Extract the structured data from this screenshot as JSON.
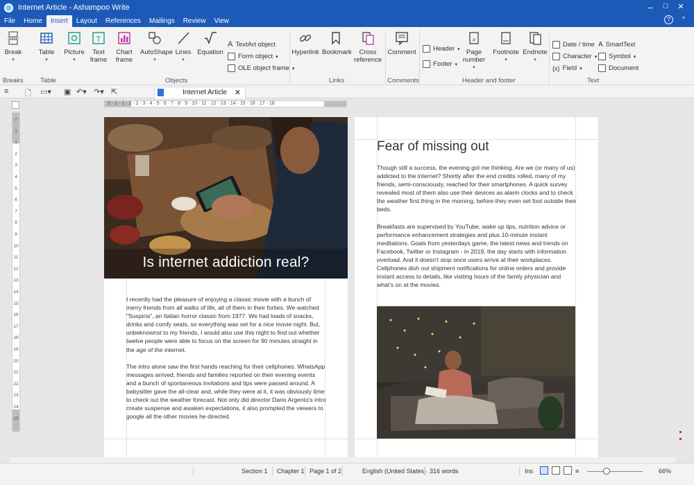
{
  "window": {
    "title": "Internet Article - Ashampoo Write",
    "minimize": "–",
    "maximize": "□",
    "close": "✕",
    "help": "?"
  },
  "menu": [
    "File",
    "Home",
    "Insert",
    "Layout",
    "References",
    "Mailings",
    "Review",
    "View"
  ],
  "ribbon": {
    "break": "Break",
    "table": "Table",
    "picture": "Picture",
    "text_frame": "Text frame",
    "chart_frame": "Chart frame",
    "autoshape": "AutoShape",
    "lines": "Lines",
    "equation": "Equation",
    "textart": "TextArt object",
    "form_object": "Form object",
    "ole_object": "OLE object frame",
    "hyperlink": "Hyperlink",
    "bookmark": "Bookmark",
    "cross_reference": "Cross reference",
    "comment": "Comment",
    "header": "Header",
    "footer": "Footer",
    "page_number": "Page number",
    "footnote": "Footnote",
    "endnote": "Endnote",
    "date_time": "Date / time",
    "character": "Character",
    "field": "Field",
    "smarttext": "SmartText",
    "symbol": "Symbol",
    "document": "Document",
    "groups": {
      "breaks": "Breaks",
      "table": "Table",
      "objects": "Objects",
      "links": "Links",
      "comments": "Comments",
      "header_footer": "Header and footer",
      "text": "Text"
    }
  },
  "doc_tab": {
    "name": "Internet Article",
    "close": "✕"
  },
  "ruler_text": "2 · 1 · 1 · 1 · 2 · 3 · 4 · 5 · 6 · 7 · 8 · 9 · 10 · 11 · 12 · 13 · 14 · 15 · 16 · 17 · 18",
  "vruler": [
    "2",
    "1",
    "1",
    "2",
    "3",
    "4",
    "5",
    "6",
    "7",
    "8",
    "9",
    "10",
    "11",
    "12",
    "13",
    "14",
    "15",
    "16",
    "17",
    "18",
    "19",
    "20",
    "21",
    "22",
    "23",
    "24",
    "25"
  ],
  "page1": {
    "hero_title": "Is internet addiction real?",
    "paragraphs": [
      "I recently had the pleasure of enjoying a classic movie with a bunch of merry friends from all walks of life, all of them in their forties. We watched \"Suspiria\", an Italian horror classic from 1977. We had loads of snacks, drinks and comfy seats, so everything was set for a nice movie night. But, unbeknownst to my friends, I would also use this night to find out whether twelve people were able to focus on the screen for 90 minutes straight in the age of the internet.",
      "The intro alone saw the first hands reaching for their cellphones. WhatsApp messages arrived, friends and families reported on their evening events and a bunch of spontaneous invitations and tips were passed around. A babysitter gave the all-clear and, while they were at it, it was obviously time to check out the weather forecast. Not only did director Dario Argento's intro create suspense and awaken expectations, it also prompted the viewers to google all the other movies he directed."
    ]
  },
  "page2": {
    "heading": "Fear of missing out",
    "paragraphs": [
      "Though still a success, the evening got me thinking. Are we (or many of us) addicted to the internet? Shortly after the end credits rolled, many of my friends, semi-consciously, reached for their smartphones. A quick survey revealed most of them also use their devices as alarm clocks and to check the weather first thing in the morning, before they even set foot outside their beds.",
      "Breakfasts are supervised by YouTube, wake up tips, nutrition advice or performance enhancement strategies and plus 10-minute instant meditations. Goals from yesterdays game, the latest news and trends on Facebook, Twitter or Instagram - in 2019, the day starts with information overload. And it doesn't stop once users arrive at their workplaces. Cellphones dish out shipment notifications for online orders and provide instant access to details, like visiting hours of the family physician and what's on at the movies."
    ]
  },
  "status": {
    "section": "Section 1",
    "chapter": "Chapter 1",
    "page": "Page 1 of 2",
    "language": "English (United States)",
    "words": "316 words",
    "mode": "Ins",
    "zoom": "66%"
  },
  "colors": {
    "titlebar": "#1c5ab8",
    "ribbon": "#f3f3f3",
    "workspace": "#e6e6e6"
  }
}
